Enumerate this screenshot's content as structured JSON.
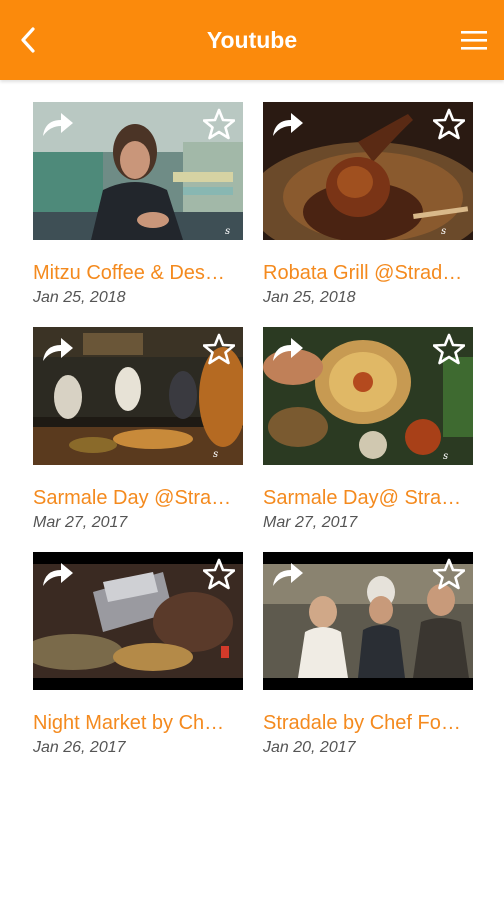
{
  "header": {
    "title": "Youtube",
    "back_icon": "chevron-left-icon",
    "menu_icon": "hamburger-menu-icon",
    "background_color": "#fb8a0c"
  },
  "videos": [
    {
      "title": "Mitzu Coffee & Des…",
      "date": "Jan 25, 2018"
    },
    {
      "title": "Robata Grill @Strad…",
      "date": "Jan 25, 2018"
    },
    {
      "title": "Sarmale Day @Stra…",
      "date": "Mar 27, 2017"
    },
    {
      "title": "Sarmale Day@ Stra…",
      "date": "Mar 27, 2017"
    },
    {
      "title": "Night Market by Ch…",
      "date": "Jan 26, 2017"
    },
    {
      "title": "Stradale by Chef Fo…",
      "date": "Jan 20, 2017"
    }
  ],
  "card_icons": {
    "share": "share-arrow-icon",
    "favorite": "star-outline-icon"
  },
  "colors": {
    "title_accent": "#f48a1e",
    "date_text": "#555555"
  }
}
